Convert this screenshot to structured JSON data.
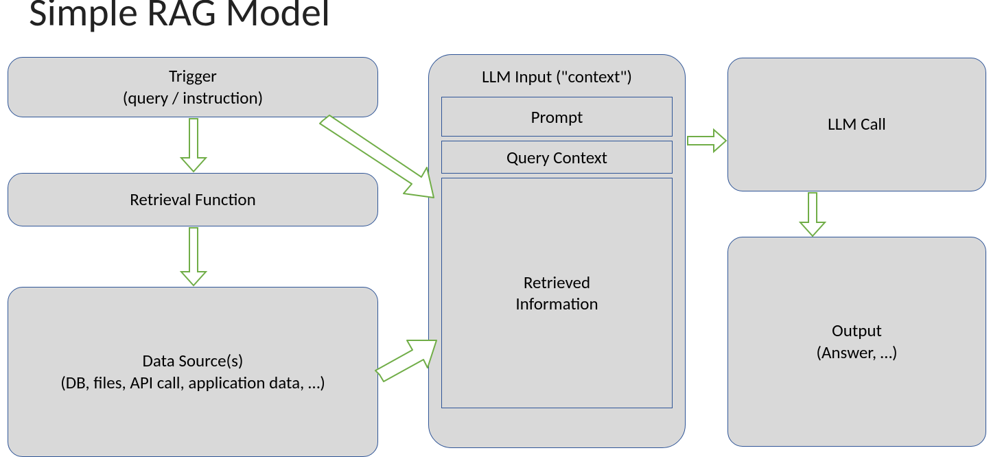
{
  "title": "Simple RAG Model",
  "boxes": {
    "trigger": {
      "line1": "Trigger",
      "line2": "(query / instruction)"
    },
    "retrieval": "Retrieval Function",
    "datasources": {
      "line1": "Data Source(s)",
      "line2": "(DB, files, API call, application data, …)"
    },
    "context": {
      "title": "LLM Input (\"context\")",
      "prompt": "Prompt",
      "query_context": "Query Context",
      "retrieved": {
        "line1": "Retrieved",
        "line2": "Information"
      }
    },
    "llm_call": "LLM Call",
    "output": {
      "line1": "Output",
      "line2": "(Answer, …)"
    }
  },
  "colors": {
    "box_fill": "#d9d9d9",
    "box_border": "#2f5597",
    "arrow_stroke": "#70ad47",
    "arrow_fill": "#ffffff"
  }
}
